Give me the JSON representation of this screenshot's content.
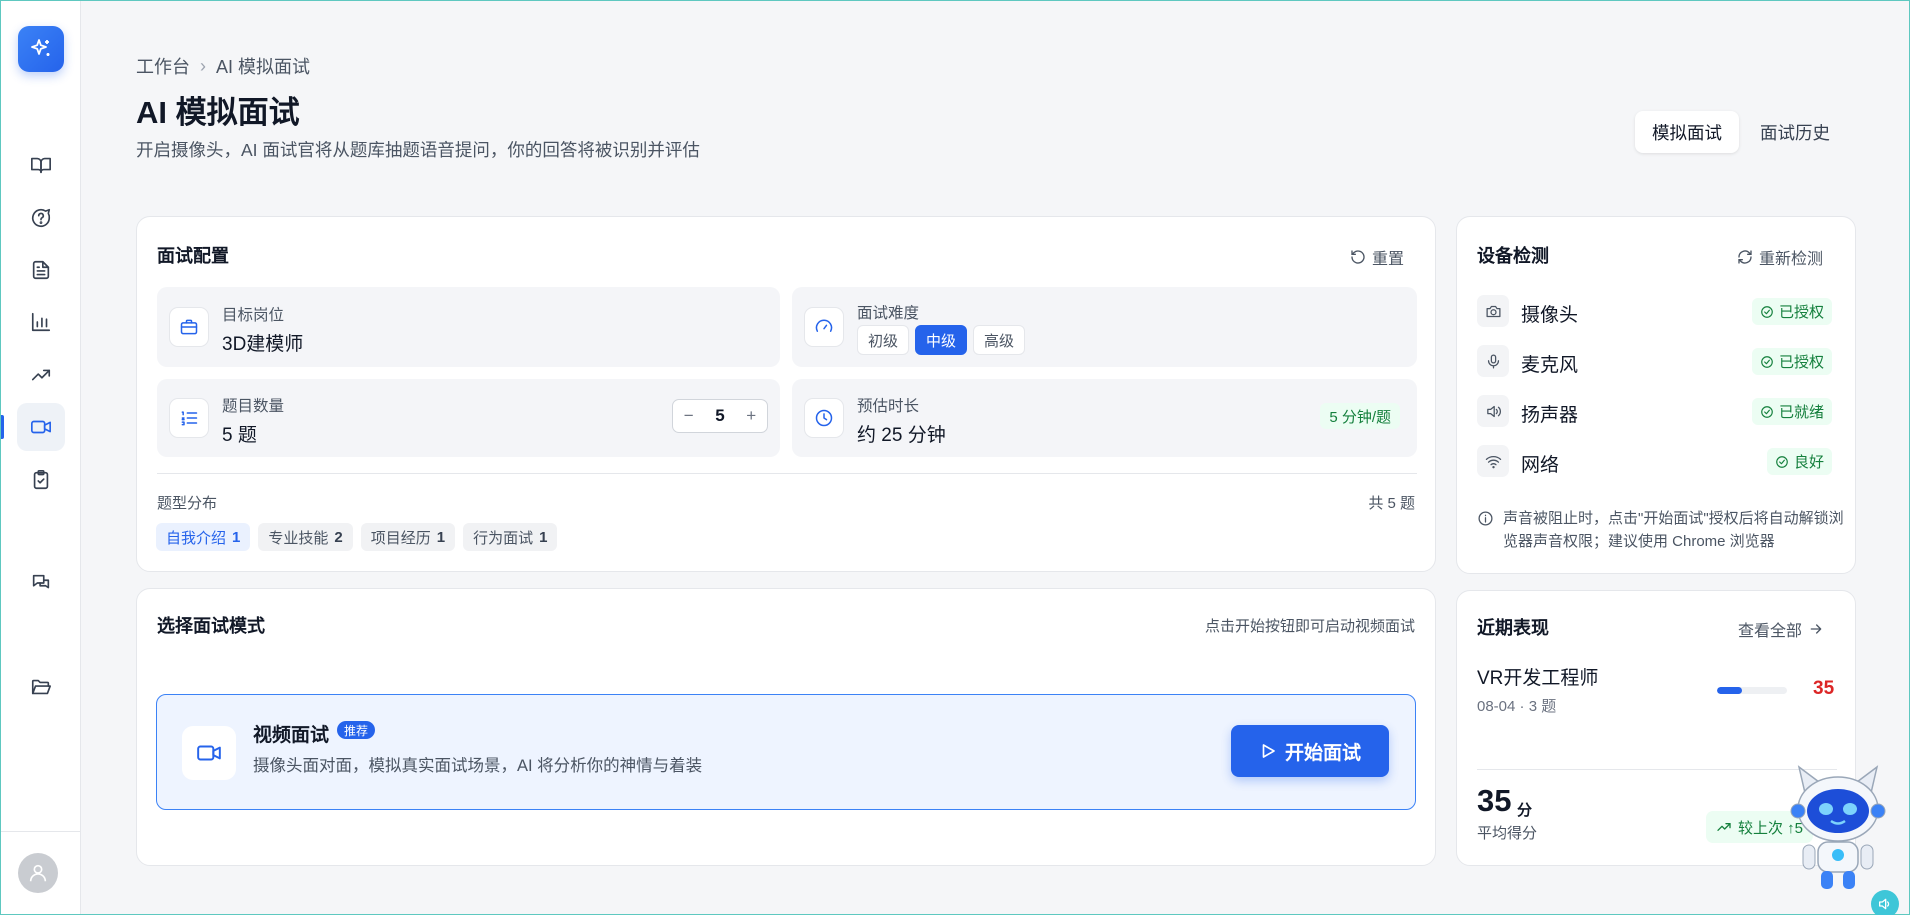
{
  "sidebar": {
    "nav_icons": [
      "book-icon",
      "help-circle-icon",
      "document-icon",
      "bar-chart-icon",
      "trending-up-icon",
      "video-icon",
      "clipboard-check-icon",
      "chat-icon",
      "folder-open-icon"
    ],
    "active": "video-icon"
  },
  "header": {
    "breadcrumb": [
      "工作台",
      "AI 模拟面试"
    ],
    "title": "AI 模拟面试",
    "subtitle": "开启摄像头，AI 面试官将从题库抽题语音提问，你的回答将被识别并评估",
    "tabs": [
      "模拟面试",
      "面试历史"
    ],
    "active_tab": "模拟面试"
  },
  "config": {
    "title": "面试配置",
    "reset_label": "重置",
    "target_role_label": "目标岗位",
    "target_role_value": "3D建模师",
    "difficulty_label": "面试难度",
    "difficulty_options": [
      "初级",
      "中级",
      "高级"
    ],
    "difficulty_selected": "中级",
    "count_label": "题目数量",
    "count_value": "5 题",
    "stepper_minus": "−",
    "stepper_value": "5",
    "stepper_plus": "+",
    "duration_label": "预估时长",
    "duration_value": "约 25 分钟",
    "rate_badge": "5 分钟/题",
    "distribution_label": "题型分布",
    "distribution_total": "共 5 题",
    "distribution": [
      {
        "label": "自我介绍",
        "count": "1"
      },
      {
        "label": "专业技能",
        "count": "2"
      },
      {
        "label": "项目经历",
        "count": "1"
      },
      {
        "label": "行为面试",
        "count": "1"
      }
    ]
  },
  "mode": {
    "title": "选择面试模式",
    "hint": "点击开始按钮即可启动视频面试",
    "name": "视频面试",
    "badge": "推荐",
    "desc": "摄像头面对面，模拟真实面试场景，AI 将分析你的神情与着装",
    "start_label": "开始面试"
  },
  "devices": {
    "title": "设备检测",
    "recheck_label": "重新检测",
    "items": [
      {
        "name": "摄像头",
        "status": "已授权",
        "icon": "camera-icon"
      },
      {
        "name": "麦克风",
        "status": "已授权",
        "icon": "microphone-icon"
      },
      {
        "name": "扬声器",
        "status": "已就绪",
        "icon": "speaker-icon"
      },
      {
        "name": "网络",
        "status": "良好",
        "icon": "wifi-icon"
      }
    ],
    "note": "声音被阻止时，点击\"开始面试\"授权后将自动解锁浏览器声音权限；建议使用 Chrome 浏览器"
  },
  "recent": {
    "title": "近期表现",
    "view_all_label": "查看全部",
    "item": {
      "role": "VR开发工程师",
      "meta": "08-04 · 3 题",
      "score": "35",
      "progress": 0.35
    },
    "avg_score": "35",
    "avg_unit": "分",
    "avg_label": "平均得分",
    "trend_label": "较上次 ↑5"
  },
  "colors": {
    "accent": "#2563eb",
    "success": "#15803d",
    "danger": "#dc2626"
  }
}
